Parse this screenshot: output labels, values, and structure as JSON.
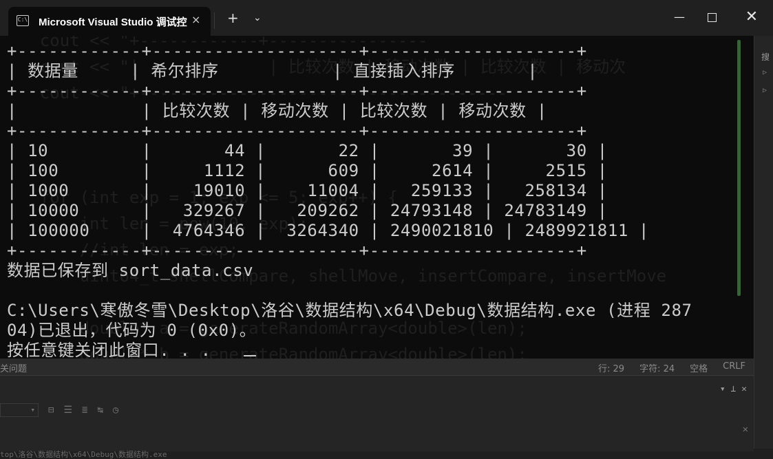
{
  "window": {
    "tab_title": "Microsoft Visual Studio 调试控",
    "tab_icon_glyph": "C:\\",
    "tab_close": "×",
    "new_tab": "+",
    "dropdown": "⌄",
    "minimize": "—",
    "close": "✕"
  },
  "console": {
    "lines": [
      "+------------+--------------------+--------------------+",
      "| 数据量     | 希尔排序           | 直接插入排序       |",
      "+------------+--------------------+--------------------+",
      "|            | 比较次数 | 移动次数 | 比较次数 | 移动次数 |",
      "+------------+--------------------+--------------------+",
      "| 10         |       44 |       22 |       39 |       30 |",
      "| 100        |     1112 |      609 |     2614 |     2515 |",
      "| 1000       |    19010 |    11004 |   259133 |   258134 |",
      "| 10000      |   329267 |   209262 | 24793148 | 24783149 |",
      "| 100000     |  4764346 |  3264340 | 2490021810 | 2489921811 |",
      "+------------+--------------------+--------------------+",
      "数据已保存到 sort_data.csv",
      "",
      "C:\\Users\\寒傲冬雪\\Desktop\\洛谷\\数据结构\\x64\\Debug\\数据结构.exe (进程 287",
      "04)已退出，代码为 0 (0x0)。",
      "按任意键关闭此窗口. . ."
    ],
    "table": {
      "headers": [
        "数据量",
        "希尔排序",
        "直接插入排序"
      ],
      "subheaders": [
        "比较次数",
        "移动次数",
        "比较次数",
        "移动次数"
      ],
      "rows": [
        [
          "10",
          "44",
          "22",
          "39",
          "30"
        ],
        [
          "100",
          "1112",
          "609",
          "2614",
          "2515"
        ],
        [
          "1000",
          "19010",
          "11004",
          "259133",
          "258134"
        ],
        [
          "10000",
          "329267",
          "209262",
          "24793148",
          "24783149"
        ],
        [
          "100000",
          "4764346",
          "3264340",
          "2490021810",
          "2489921811"
        ]
      ]
    }
  },
  "ide_background": {
    "ghost_code": "    cout << \"+------------+----------------\n    cout << \"|             | 比较次数 | 移动次数 | 比较次数 | 移动次\n    cout << \"+-------------------------------------\n\n\n\n    for (int exp = 1; exp <= 5; exp++) {\n        int len = pow(10, exp);\n        //int len = exp;\n        uint64_t shellCompare, shellMove, insertCompare, insertMove\n\n        double* a = generateRandomArray<double>(len);\n        double* b = generateRandomArray<double>(len);\n        copy(a, a + len, b);  // 标准库复制",
    "status_left": "关问题",
    "status_line": "行: 29",
    "status_col": "字符: 24",
    "status_space": "空格",
    "status_eol": "CRLF",
    "search_hint": "搜",
    "path_text": "top\\洛谷\\数据结构\\x64\\Debug\\数据结构.exe",
    "pin_glyph": "▾ ⊥ ✕"
  }
}
